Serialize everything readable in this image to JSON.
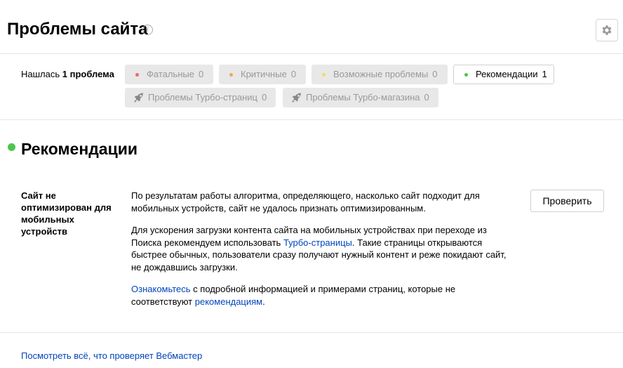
{
  "header": {
    "title": "Проблемы сайта",
    "info_icon": "info-icon",
    "settings_icon": "gear-icon"
  },
  "filters": {
    "found_prefix": "Нашлась ",
    "found_count": "1 проблема",
    "chips": [
      {
        "label": "Фатальные",
        "count": "0",
        "dot_color": "#f06767",
        "active": false
      },
      {
        "label": "Критичные",
        "count": "0",
        "dot_color": "#f7a35c",
        "active": false
      },
      {
        "label": "Возможные проблемы",
        "count": "0",
        "dot_color": "#f9d66a",
        "active": false
      },
      {
        "label": "Рекомендации",
        "count": "1",
        "dot_color": "#4cc74c",
        "active": true
      },
      {
        "label": "Проблемы Турбо-страниц",
        "count": "0",
        "icon": "rocket-icon",
        "active": false
      },
      {
        "label": "Проблемы Турбо-магазина",
        "count": "0",
        "icon": "rocket-icon",
        "active": false
      }
    ]
  },
  "section": {
    "title": "Рекомендации",
    "dot_color": "#4cc74c"
  },
  "issue": {
    "name": "Сайт не оптимизирован для мобильных устройств",
    "p1": "По результатам работы алгоритма, определяющего, насколько сайт подходит для мобильных устройств, сайт не удалось признать оптимизированным.",
    "p2_before": "Для ускорения загрузки контента сайта на мобильных устройствах при переходе из Поиска рекомендуем использовать ",
    "p2_link": "Турбо-страницы",
    "p2_after": ". Такие страницы открываются быстрее обычных, пользователи сразу получают нужный контент и реже покидают сайт, не дождавшись загрузки.",
    "p3_link1": "Ознакомьтесь",
    "p3_middle": " с подробной информацией и примерами страниц, которые не соответствуют ",
    "p3_link2": "рекомендациям",
    "p3_end": ".",
    "check_label": "Проверить"
  },
  "footer": {
    "link": "Посмотреть всё, что проверяет Вебмастер"
  },
  "colors": {
    "link": "#0044bb",
    "chip_bg": "#e8e8e8",
    "muted_text": "#999999"
  }
}
